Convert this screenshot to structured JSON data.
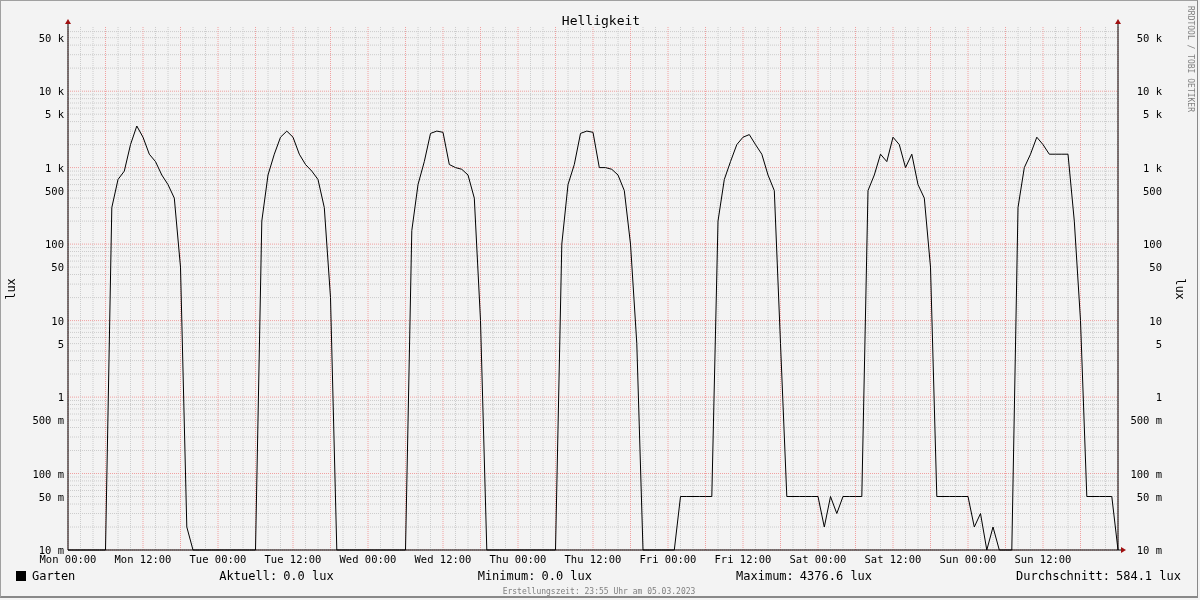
{
  "graph": {
    "title": "Helligkeit",
    "ylabel": "lux",
    "x_ticks": [
      "Mon 00:00",
      "Mon 12:00",
      "Tue 00:00",
      "Tue 12:00",
      "Wed 00:00",
      "Wed 12:00",
      "Thu 00:00",
      "Thu 12:00",
      "Fri 00:00",
      "Fri 12:00",
      "Sat 00:00",
      "Sat 12:00",
      "Sun 00:00",
      "Sun 12:00"
    ],
    "left_ticks": [
      "50 k",
      "10 k",
      "5 k",
      "1 k",
      "500",
      "100",
      "50",
      "10",
      "5",
      "1",
      "500 m",
      "100 m",
      "50 m",
      "10 m"
    ]
  },
  "right_axis": {
    "label": "lux",
    "ticks": [
      "50 k",
      "10 k",
      "5 k",
      "1 k",
      "500",
      "100",
      "50",
      "10",
      "5",
      "1",
      "500 m",
      "100 m",
      "50 m",
      "10 m"
    ]
  },
  "credit": "RRDTOOL / TOBI OETIKER",
  "legend": {
    "series": {
      "name": "Garten",
      "color": "#000000"
    },
    "stats": [
      {
        "label": "Aktuell:",
        "value": "0.0 lux"
      },
      {
        "label": "Minimum:",
        "value": "0.0 lux"
      },
      {
        "label": "Maximum:",
        "value": "4376.6 lux"
      },
      {
        "label": "Durchschnitt:",
        "value": "584.1 lux"
      }
    ]
  },
  "footer": "Erstellungszeit: 23:55 Uhr am 05.03.2023"
}
